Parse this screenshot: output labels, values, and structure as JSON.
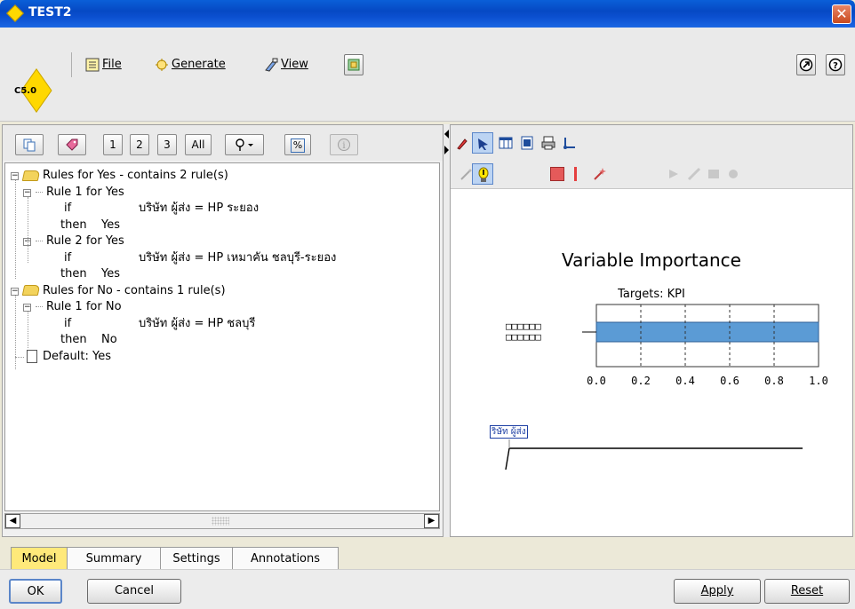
{
  "window": {
    "title": "TEST2",
    "close_label": "✕"
  },
  "menu": {
    "file_label": "File",
    "generate_label": "Generate",
    "view_label": "View"
  },
  "model_icon": {
    "label": "C5.0"
  },
  "toolbar_left": {
    "btn1": "1",
    "btn2": "2",
    "btn3": "3",
    "btn_all": "All",
    "btn_percent": "%"
  },
  "tree": [
    {
      "level": 0,
      "kind": "folder",
      "text": "Rules for Yes - contains 2 rule(s)"
    },
    {
      "level": 1,
      "kind": "rule",
      "text": "Rule 1 for  Yes"
    },
    {
      "level": 2,
      "kind": "if",
      "kw": "if",
      "text": "บริษัท ผู้ส่ง = HP  ระยอง"
    },
    {
      "level": 2,
      "kind": "then",
      "kw": "then",
      "text": "Yes"
    },
    {
      "level": 1,
      "kind": "rule",
      "text": "Rule 2 for  Yes"
    },
    {
      "level": 2,
      "kind": "if",
      "kw": "if",
      "text": "บริษัท ผู้ส่ง = HP เหมาคัน ชลบุรี-ระยอง"
    },
    {
      "level": 2,
      "kind": "then",
      "kw": "then",
      "text": "Yes"
    },
    {
      "level": 0,
      "kind": "folder",
      "text": "Rules for No - contains 1 rule(s)"
    },
    {
      "level": 1,
      "kind": "rule",
      "text": "Rule 1 for  No"
    },
    {
      "level": 2,
      "kind": "if",
      "kw": "if",
      "text": "บริษัท ผู้ส่ง = HP ชลบุรี"
    },
    {
      "level": 2,
      "kind": "then",
      "kw": "then",
      "text": "No"
    },
    {
      "level": 0,
      "kind": "default",
      "text": "Default: Yes"
    }
  ],
  "chart_data": {
    "type": "bar",
    "orientation": "horizontal",
    "title": "Variable Importance",
    "subtitle": "Targets: KPI",
    "categories": [
      "□□□□□□\n□□□□□□"
    ],
    "values": [
      1.0
    ],
    "xlim": [
      0.0,
      1.0
    ],
    "xticks": [
      "0.0",
      "0.2",
      "0.4",
      "0.6",
      "0.8",
      "1.0"
    ],
    "bar_color": "#5b9bd5",
    "grid": true
  },
  "tree_viz": {
    "node_label": "ริษัท ผู้ส่ง"
  },
  "tabs": [
    {
      "label": "Model",
      "active": true
    },
    {
      "label": "Summary",
      "active": false
    },
    {
      "label": "Settings",
      "active": false
    },
    {
      "label": "Annotations",
      "active": false
    }
  ],
  "buttons": {
    "ok": "OK",
    "cancel": "Cancel",
    "apply": "Apply",
    "reset": "Reset"
  },
  "colors": {
    "accent": "#0b4fcf",
    "active_tab": "#ffe97a",
    "bar": "#5b9bd5"
  }
}
